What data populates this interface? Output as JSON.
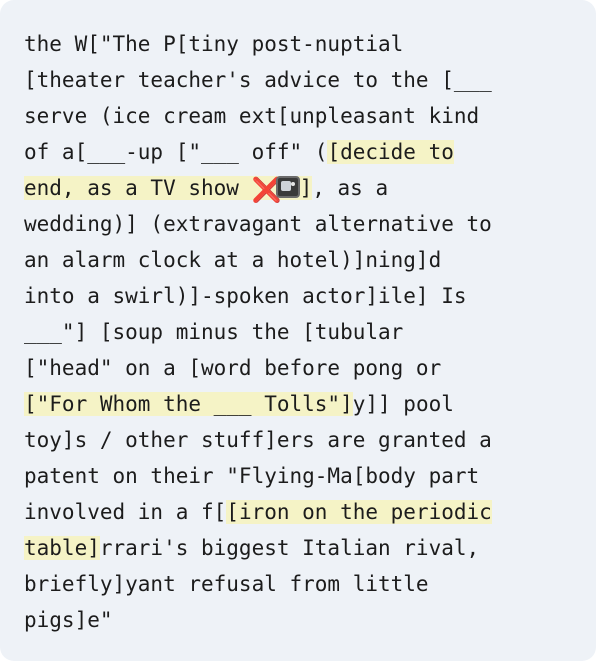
{
  "lines": [
    "the W[\"The P[tiny post-nuptial",
    "[theater teacher's advice to the [___",
    "serve (ice cream ext[unpleasant kind",
    "of a[___-up [\"___ off\" (",
    "[decide to",
    "end, as a TV show ",
    "]",
    ", as a",
    "wedding)] (extravagant alternative to",
    "an alarm clock at a hotel)]ning]d",
    "into a swirl)]-spoken actor]ile] Is",
    "___\"] [soup minus the [tubular",
    "[\"head\" on a [word before pong or",
    "[\"For Whom the ___ Tolls\"]",
    "y]] pool",
    "toy]s / other stuff]ers are granted a",
    "patent on their \"Flying-Ma[body part",
    "involved in a f[",
    "[iron on the periodic",
    "table]",
    "rrari's biggest Italian rival,",
    "briefly]yant refusal from little",
    "pigs]e\""
  ],
  "icons": {
    "x": "❌",
    "tv": "📺"
  },
  "colors": {
    "card_background": "#eef2f7",
    "highlight": "#f5f3c6",
    "text": "#1c1c1c",
    "x_mark": "#e0332c"
  }
}
